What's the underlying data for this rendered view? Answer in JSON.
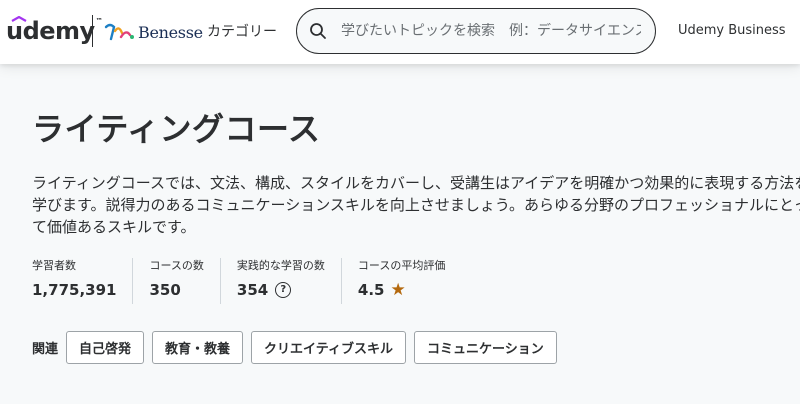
{
  "header": {
    "brand": "udemy",
    "trademark": "™",
    "partner": "Benesse",
    "categories_label": "カテゴリー",
    "search_placeholder": "学びたいトピックを検索　例：データサイエンス，フ",
    "business_label": "Udemy Business"
  },
  "main": {
    "title": "ライティングコース",
    "description": "ライティングコースでは、文法、構成、スタイルをカバーし、受講生はアイデアを明確かつ効果的に表現する方法を学びます。説得力のあるコミュニケーションスキルを向上させましょう。あらゆる分野のプロフェッショナルにとって価値あるスキルです。"
  },
  "stats": [
    {
      "label": "学習者数",
      "value": "1,775,391"
    },
    {
      "label": "コースの数",
      "value": "350"
    },
    {
      "label": "実践的な学習の数",
      "value": "354"
    },
    {
      "label": "コースの平均評価",
      "value": "4.5"
    }
  ],
  "related": {
    "label": "関連",
    "topics": [
      "自己啓発",
      "教育・教養",
      "クリエイティブスキル",
      "コミュニケーション"
    ]
  },
  "icons": {
    "search": "search-icon",
    "help": "question-circle-icon",
    "rating": "star-icon"
  },
  "colors": {
    "brand_purple": "#a435f0",
    "star": "#b4690e",
    "text": "#2d2f31",
    "background": "#f7f9fa"
  }
}
